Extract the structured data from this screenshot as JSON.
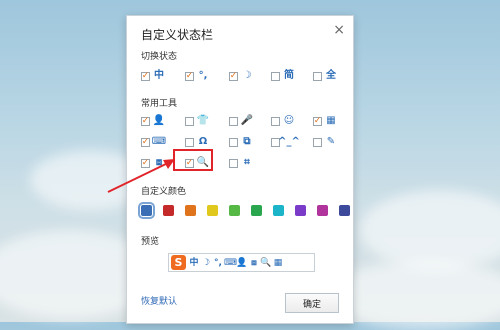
{
  "dialog": {
    "title": "自定义状态栏",
    "close_glyph": "×",
    "sections": {
      "switch_state": "切换状态",
      "common_tools": "常用工具",
      "custom_color": "自定义颜色",
      "preview": "预览"
    },
    "switch_items": [
      {
        "icon": "zh-icon",
        "glyph": "中",
        "checked": true
      },
      {
        "icon": "punctuation-icon",
        "glyph": "°,",
        "checked": true
      },
      {
        "icon": "moon-icon",
        "glyph": "☽",
        "checked": true
      },
      {
        "icon": "simplified-icon",
        "glyph": "简",
        "checked": false
      },
      {
        "icon": "fullwidth-icon",
        "glyph": "全",
        "checked": false
      }
    ],
    "tool_rows": [
      [
        {
          "icon": "user-icon",
          "glyph": "👤",
          "checked": true
        },
        {
          "icon": "shirt-icon",
          "glyph": "👕",
          "checked": false
        },
        {
          "icon": "microphone-icon",
          "glyph": "🎤",
          "checked": false
        },
        {
          "icon": "smiley-icon",
          "glyph": "☺",
          "checked": false
        },
        {
          "icon": "grid-icon",
          "glyph": "▦",
          "checked": true
        }
      ],
      [
        {
          "icon": "keyboard-icon",
          "glyph": "⌨",
          "checked": true
        },
        {
          "icon": "headphones-icon",
          "glyph": "Ω",
          "checked": false
        },
        {
          "icon": "copy-icon",
          "glyph": "⧉",
          "checked": false
        },
        {
          "icon": "emoticon-icon",
          "glyph": "^_^",
          "checked": false
        },
        {
          "icon": "pen-icon",
          "glyph": "✎",
          "checked": false
        }
      ],
      [
        {
          "icon": "toolbox-icon",
          "glyph": "⧈",
          "checked": true
        },
        {
          "icon": "search-icon",
          "glyph": "🔍",
          "checked": true
        },
        {
          "icon": "crop-icon",
          "glyph": "⌗",
          "checked": false
        }
      ]
    ],
    "checkmark": "✓",
    "colors": [
      "#3a6fb5",
      "#c42a2a",
      "#e0741c",
      "#e0c81c",
      "#56b946",
      "#2aa64e",
      "#1cb4c8",
      "#7a3cc8",
      "#b0349c",
      "#3d4a9c"
    ],
    "selected_color_index": 0,
    "preview_logo": "S",
    "preview_icons": [
      {
        "icon": "zh-icon",
        "glyph": "中"
      },
      {
        "icon": "moon-icon",
        "glyph": "☽"
      },
      {
        "icon": "punctuation-icon",
        "glyph": "°,"
      },
      {
        "icon": "keyboard-icon",
        "glyph": "⌨"
      },
      {
        "icon": "user-icon",
        "glyph": "👤"
      },
      {
        "icon": "toolbox-icon",
        "glyph": "⧈"
      },
      {
        "icon": "search-icon",
        "glyph": "🔍"
      },
      {
        "icon": "grid-icon",
        "glyph": "▦"
      }
    ],
    "restore_label": "恢复默认",
    "ok_label": "确定"
  }
}
